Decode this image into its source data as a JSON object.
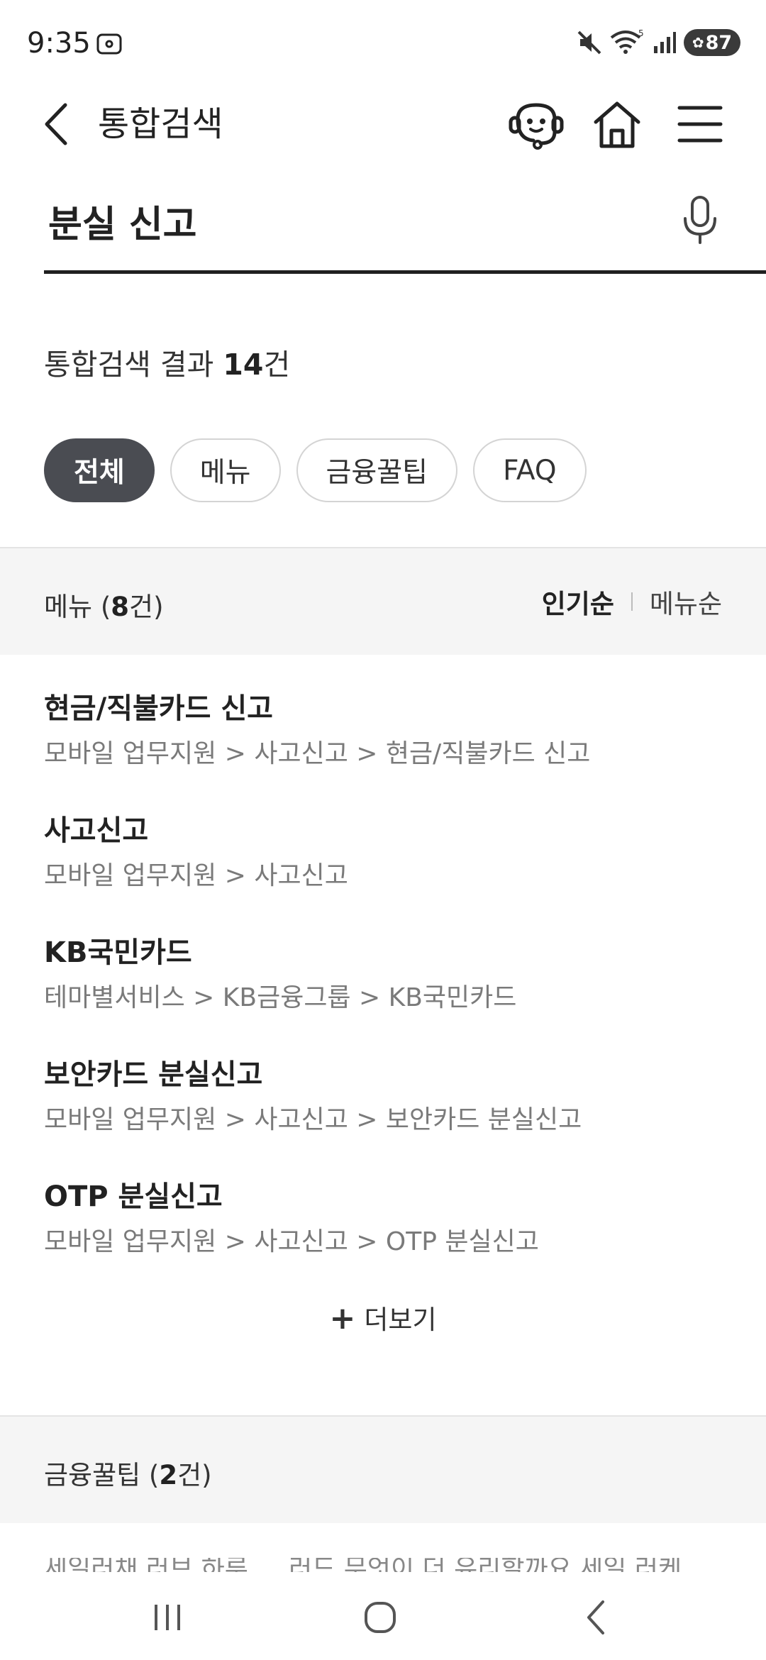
{
  "status_bar": {
    "time": "9:35",
    "signal_badge": "5",
    "battery": "87"
  },
  "header": {
    "title": "통합검색"
  },
  "search": {
    "query": "분실 신고"
  },
  "results": {
    "prefix": "통합검색 결과 ",
    "count": "14",
    "suffix": "건"
  },
  "filters": [
    {
      "label": "전체",
      "active": true
    },
    {
      "label": "메뉴",
      "active": false
    },
    {
      "label": "금융꿀팁",
      "active": false
    },
    {
      "label": "FAQ",
      "active": false
    }
  ],
  "menu_section": {
    "title_prefix": "메뉴 (",
    "count": "8",
    "title_suffix": "건)",
    "sort_popular": "인기순",
    "sort_menu": "메뉴순",
    "items": [
      {
        "title": "현금/직불카드 신고",
        "path": "모바일 업무지원  >  사고신고  >  현금/직불카드 신고"
      },
      {
        "title": "사고신고",
        "path": "모바일 업무지원  >  사고신고"
      },
      {
        "title": "KB국민카드",
        "path": "테마별서비스  >  KB금융그룹  >  KB국민카드"
      },
      {
        "title": "보안카드 분실신고",
        "path": "모바일 업무지원  >  사고신고  >  보안카드 분실신고"
      },
      {
        "title": "OTP 분실신고",
        "path": "모바일 업무지원  >  사고신고  >  OTP 분실신고"
      }
    ],
    "more_label": "더보기"
  },
  "tips_section": {
    "title_prefix": "금융꿀팁 (",
    "count": "2",
    "title_suffix": "건)",
    "preview_text": "세일러채 러브 하루 ... 러드 무엇이 더 유리할까요 세일 러케 ..."
  },
  "icons": {
    "back": "chevron-left-icon",
    "chatbot": "chatbot-icon",
    "home": "home-icon",
    "menu": "hamburger-icon",
    "mic": "microphone-icon",
    "more": "plus-icon"
  },
  "colors": {
    "active_chip": "#4a4c52",
    "section_bg": "#f5f5f5",
    "path_text": "#7a7a7a"
  }
}
